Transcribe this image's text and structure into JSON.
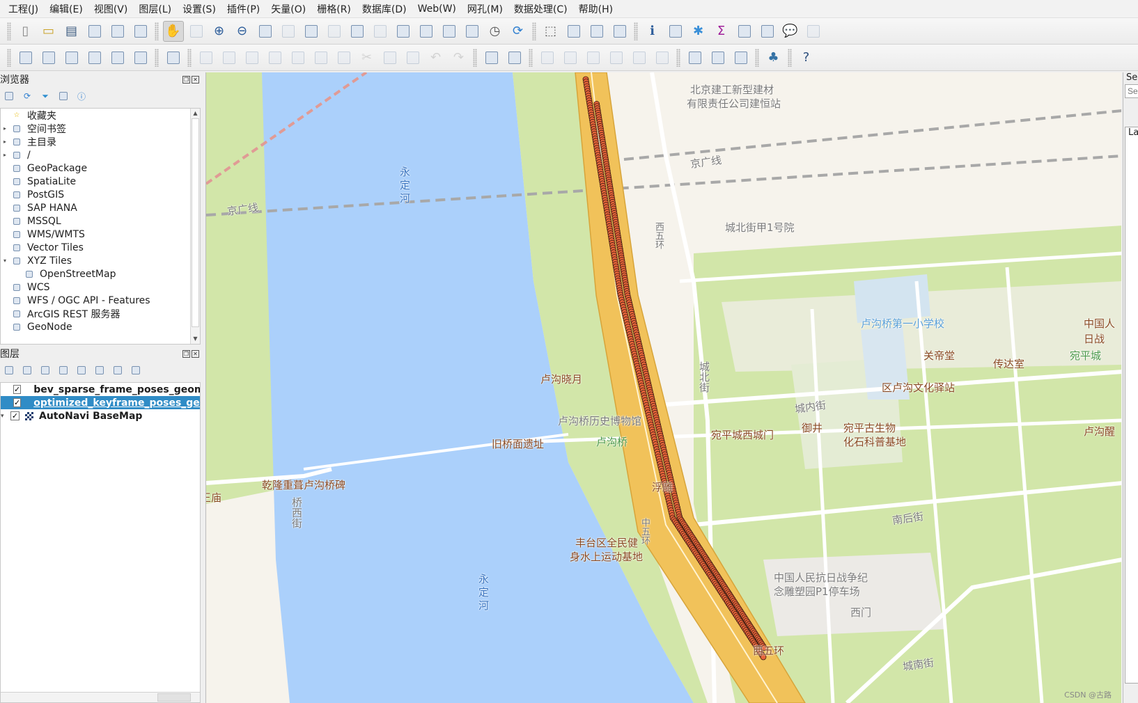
{
  "menubar": [
    "工程(J)",
    "编辑(E)",
    "视图(V)",
    "图层(L)",
    "设置(S)",
    "插件(P)",
    "矢量(O)",
    "栅格(R)",
    "数据库(D)",
    "Web(W)",
    "网孔(M)",
    "数据处理(C)",
    "帮助(H)"
  ],
  "toolbar1": {
    "groups": [
      [
        "new-project-icon",
        "open-project-icon",
        "save-project-icon",
        "new-print-layout-icon",
        "layout-manager-icon",
        "style-manager-icon"
      ],
      [
        "pan-map-icon",
        "pan-to-selection-icon",
        "zoom-in-icon",
        "zoom-out-icon",
        "zoom-full-icon",
        "zoom-to-selection-icon",
        "zoom-to-layer-icon",
        "zoom-native-icon",
        "zoom-last-icon",
        "zoom-next-icon",
        "new-map-view-icon",
        "new-3d-map-view-icon",
        "new-spatial-bookmark-icon",
        "show-bookmarks-icon",
        "temporal-controller-icon",
        "refresh-icon"
      ],
      [
        "select-features-icon",
        "select-by-value-icon",
        "deselect-icon",
        "select-by-location-icon"
      ],
      [
        "identify-features-icon",
        "attribute-table-icon",
        "processing-toolbox-icon",
        "statistics-icon",
        "open-field-calculator-icon",
        "measure-icon",
        "map-tips-icon",
        "actions-icon"
      ]
    ],
    "active": "pan-map-icon"
  },
  "toolbar2": {
    "groups": [
      [
        "data-source-manager-icon",
        "new-geopackage-layer-icon",
        "new-shapefile-layer-icon",
        "new-spatialite-layer-icon",
        "new-temporary-scratch-layer-icon",
        "new-virtual-layer-icon"
      ],
      [
        "digitizing-icon"
      ],
      [
        "current-edits-icon",
        "toggle-editing-icon",
        "save-layer-edits-icon",
        "add-point-feature-icon",
        "vertex-tool-icon",
        "modify-attributes-icon",
        "delete-selected-icon",
        "cut-features-icon",
        "copy-features-icon",
        "paste-features-icon",
        "undo-icon",
        "redo-icon"
      ],
      [
        "label-toolbar-icon",
        "diagram-options-icon"
      ],
      [
        "highlight-pinned-labels-icon",
        "pin-unpin-labels-icon",
        "show-hide-labels-icon",
        "move-label-icon",
        "rotate-label-icon",
        "change-label-icon"
      ],
      [
        "quickmapservices-search-icon",
        "quickmapservices-add-icon",
        "quickmapservices-settings-icon"
      ],
      [
        "python-console-icon"
      ],
      [
        "help-icon"
      ]
    ]
  },
  "browser": {
    "title": "浏览器",
    "tools": [
      "add-selected-layers-icon",
      "refresh-icon",
      "filter-icon",
      "collapse-all-icon",
      "properties-icon"
    ],
    "items": [
      {
        "label": "收藏夹",
        "icon": "favorites-star-icon",
        "expand": ""
      },
      {
        "label": "空间书签",
        "icon": "spatial-bookmarks-icon",
        "expand": "▸"
      },
      {
        "label": "主目录",
        "icon": "home-folder-icon",
        "expand": "▸"
      },
      {
        "label": "/",
        "icon": "folder-icon",
        "expand": "▸"
      },
      {
        "label": "GeoPackage",
        "icon": "geopackage-icon",
        "expand": ""
      },
      {
        "label": "SpatiaLite",
        "icon": "spatialite-icon",
        "expand": ""
      },
      {
        "label": "PostGIS",
        "icon": "postgis-icon",
        "expand": ""
      },
      {
        "label": "SAP HANA",
        "icon": "sap-hana-icon",
        "expand": ""
      },
      {
        "label": "MSSQL",
        "icon": "mssql-icon",
        "expand": ""
      },
      {
        "label": "WMS/WMTS",
        "icon": "wms-icon",
        "expand": ""
      },
      {
        "label": "Vector Tiles",
        "icon": "vector-tiles-icon",
        "expand": ""
      },
      {
        "label": "XYZ Tiles",
        "icon": "xyz-tiles-icon",
        "expand": "▾"
      },
      {
        "label": "OpenStreetMap",
        "icon": "xyz-tiles-icon",
        "expand": "",
        "indent": true
      },
      {
        "label": "WCS",
        "icon": "wcs-icon",
        "expand": ""
      },
      {
        "label": "WFS / OGC API - Features",
        "icon": "wfs-icon",
        "expand": ""
      },
      {
        "label": "ArcGIS REST 服务器",
        "icon": "arcgis-rest-icon",
        "expand": ""
      },
      {
        "label": "GeoNode",
        "icon": "geonode-icon",
        "expand": ""
      }
    ]
  },
  "layers": {
    "title": "图层",
    "tools": [
      "open-layer-styling-icon",
      "add-group-icon",
      "manage-visibility-icon",
      "filter-legend-icon",
      "filter-by-expression-icon",
      "expand-all-icon",
      "collapse-all-icon",
      "remove-layer-icon"
    ],
    "items": [
      {
        "name": "bev_sparse_frame_poses_geom",
        "checked": true,
        "symbol_color": "#8e6fb0",
        "selected": false,
        "type": "point"
      },
      {
        "name": "optimized_keyframe_poses_geom",
        "checked": true,
        "symbol_color": "#b07a6e",
        "selected": true,
        "type": "point"
      },
      {
        "name": "AutoNavi BaseMap",
        "checked": true,
        "symbol_color": "",
        "selected": false,
        "type": "raster",
        "expanded": true
      }
    ]
  },
  "map": {
    "labels": [
      {
        "text": "北京建工新型建材",
        "cls": "poi-gray"
      },
      {
        "text": "有限责任公司建恒站",
        "cls": "poi-gray"
      },
      {
        "text": "京广线",
        "cls": "poi-gray"
      },
      {
        "text": "京广线",
        "cls": "poi-gray"
      },
      {
        "text": "永定河",
        "cls": "poi-river"
      },
      {
        "text": "城北街甲1号院",
        "cls": "poi-gray"
      },
      {
        "text": "卢沟桥第一小学校",
        "cls": "poi-blue"
      },
      {
        "text": "关帝堂",
        "cls": "poi-brown"
      },
      {
        "text": "传达室",
        "cls": "poi-brown"
      },
      {
        "text": "宛平城",
        "cls": "poi-green"
      },
      {
        "text": "中国人",
        "cls": "poi-brown"
      },
      {
        "text": "日战",
        "cls": "poi-brown"
      },
      {
        "text": "区卢沟文化驿站",
        "cls": "poi-brown"
      },
      {
        "text": "卢沟晓月",
        "cls": "poi-brown"
      },
      {
        "text": "城北街",
        "cls": "poi-gray"
      },
      {
        "text": "卢沟桥历史博物馆",
        "cls": "poi-gray"
      },
      {
        "text": "城内街",
        "cls": "poi-gray"
      },
      {
        "text": "宛平城西城门",
        "cls": "poi-brown"
      },
      {
        "text": "御井",
        "cls": "poi-brown"
      },
      {
        "text": "宛平古生物",
        "cls": "poi-brown"
      },
      {
        "text": "化石科普基地",
        "cls": "poi-brown"
      },
      {
        "text": "卢沟醒",
        "cls": "poi-brown"
      },
      {
        "text": "旧桥面遗址",
        "cls": "poi-brown"
      },
      {
        "text": "卢沟桥",
        "cls": "poi-green"
      },
      {
        "text": "乾隆重葺卢沟桥碑",
        "cls": "poi-brown"
      },
      {
        "text": "王庙",
        "cls": "poi-brown"
      },
      {
        "text": "桥西街",
        "cls": "poi-gray"
      },
      {
        "text": "浮雕",
        "cls": "poi-brown"
      },
      {
        "text": "丰台区全民健",
        "cls": "poi-brown"
      },
      {
        "text": "身水上运动基地",
        "cls": "poi-brown"
      },
      {
        "text": "南后街",
        "cls": "poi-gray"
      },
      {
        "text": "中国人民抗日战争纪",
        "cls": "poi-gray"
      },
      {
        "text": "念雕塑园P1停车场",
        "cls": "poi-gray"
      },
      {
        "text": "西门",
        "cls": "poi-gray"
      },
      {
        "text": "永定河",
        "cls": "poi-river"
      },
      {
        "text": "西五环",
        "cls": "poi-brown"
      },
      {
        "text": "城南街",
        "cls": "poi-gray"
      },
      {
        "text": "西五环",
        "cls": "poi-gray"
      },
      {
        "text": "中五环",
        "cls": "poi-gray"
      }
    ],
    "trajectory_color": "#e8643a",
    "watermark": "CSDN @古路"
  },
  "right_dock": {
    "search_label": "Se",
    "search_placeholder": "Se",
    "panel_label": "La"
  }
}
